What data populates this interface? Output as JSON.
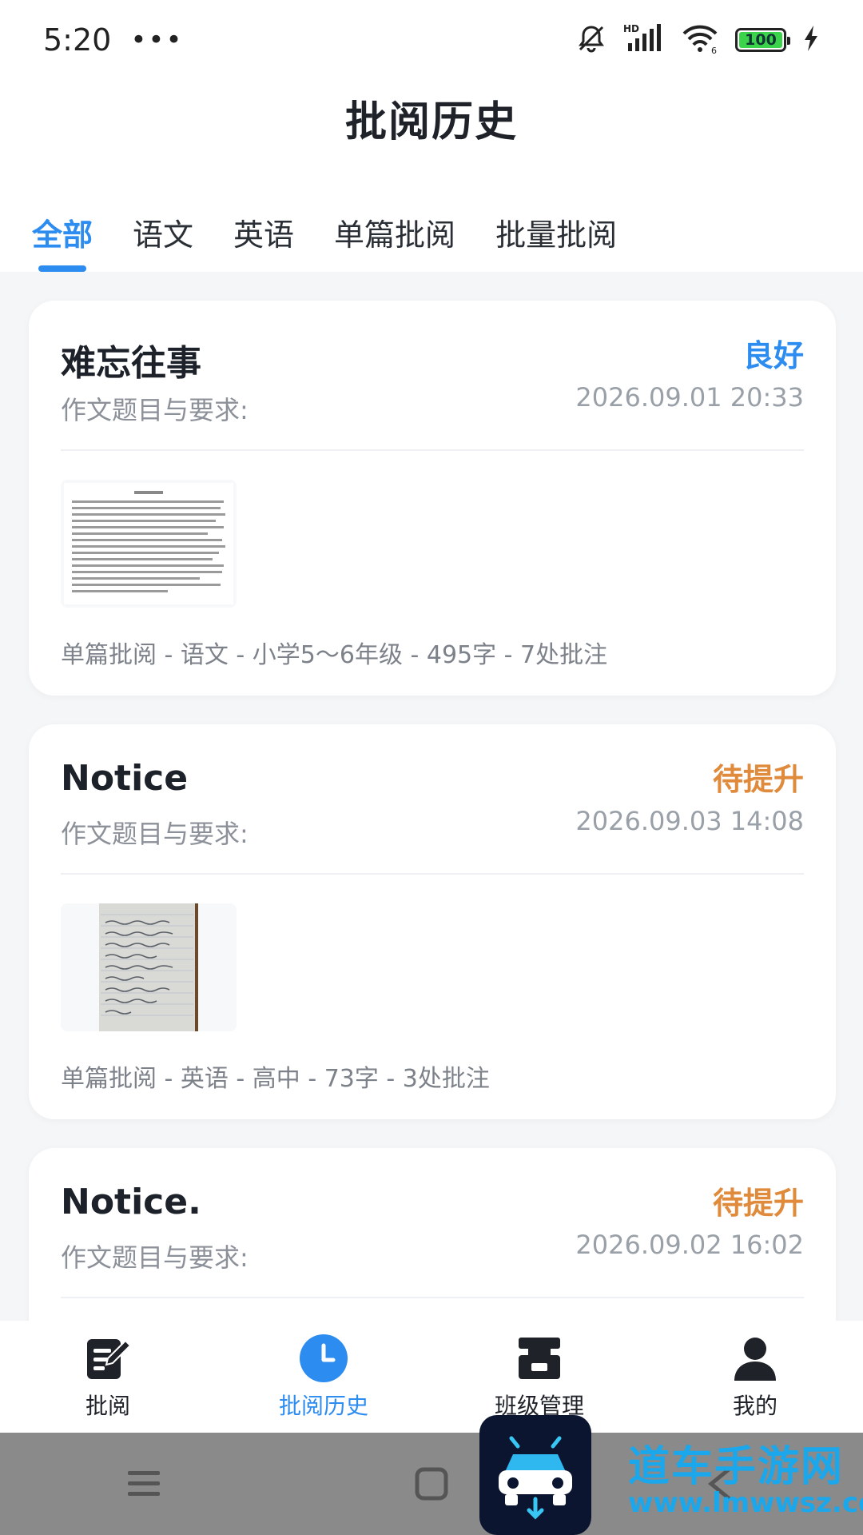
{
  "status_bar": {
    "time": "5:20",
    "dots": "•••",
    "battery": "100",
    "icons": [
      "bell-off-icon",
      "hd-signal-icon",
      "wifi-icon",
      "battery-icon",
      "charging-icon"
    ]
  },
  "header": {
    "title": "批阅历史"
  },
  "tabs": [
    {
      "label": "全部",
      "active": true
    },
    {
      "label": "语文",
      "active": false
    },
    {
      "label": "英语",
      "active": false
    },
    {
      "label": "单篇批阅",
      "active": false
    },
    {
      "label": "批量批阅",
      "active": false
    }
  ],
  "colors": {
    "accent": "#2d8cf0",
    "grade_good": "#2d8cf0",
    "grade_improve": "#e08a3c"
  },
  "cards": [
    {
      "title": "难忘往事",
      "grade": "良好",
      "subtitle": "作文题目与要求:",
      "time": "2026.09.01 20:33",
      "meta": "单篇批阅 - 语文 - 小学5～6年级 - 495字 - 7处批注"
    },
    {
      "title": "Notice",
      "grade": "待提升",
      "subtitle": "作文题目与要求:",
      "time": "2026.09.03 14:08",
      "meta": "单篇批阅 - 英语 - 高中 - 73字 - 3处批注"
    },
    {
      "title": "Notice.",
      "grade": "待提升",
      "subtitle": "作文题目与要求:",
      "time": "2026.09.02 16:02",
      "meta": ""
    }
  ],
  "bottom_nav": [
    {
      "label": "批阅",
      "icon": "edit-document-icon",
      "active": false
    },
    {
      "label": "批阅历史",
      "icon": "clock-icon",
      "active": true
    },
    {
      "label": "班级管理",
      "icon": "class-icon",
      "active": false
    },
    {
      "label": "我的",
      "icon": "user-icon",
      "active": false
    }
  ],
  "watermark": {
    "title": "道车手游网",
    "url": "www.lmwwsz.com"
  }
}
